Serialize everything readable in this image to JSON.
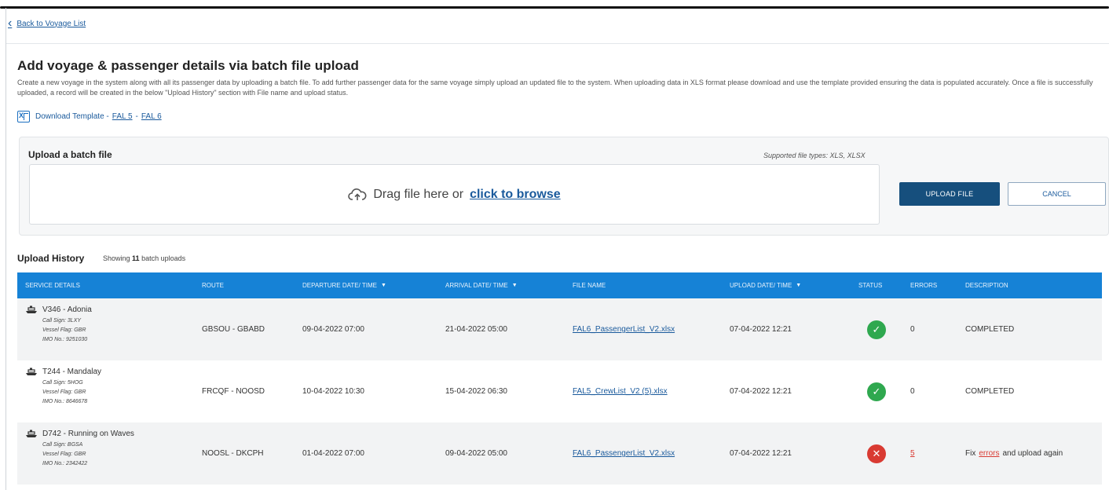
{
  "nav": {
    "back_label": "Back to Voyage List"
  },
  "page": {
    "title": "Add voyage & passenger details via batch file upload",
    "description": "Create a new voyage in the system along with all its passenger data by uploading a batch file. To add further passenger data for the same voyage simply upload an updated file to the system. When uploading data in XLS format please download and use the template provided ensuring the data is populated accurately. Once a file is successfully uploaded, a record will be created in the below \"Upload History\" section with File name and upload status."
  },
  "template": {
    "label": "Download Template -",
    "fal5": "FAL 5",
    "separator": "-",
    "fal6": "FAL 6",
    "icon": "excel-icon"
  },
  "upload": {
    "title": "Upload a batch file",
    "supported": "Supported file types: XLS, XLSX",
    "drag_text": "Drag file here or",
    "browse_text": "click to browse",
    "upload_button": "UPLOAD FILE",
    "cancel_button": "CANCEL",
    "icon": "cloud-upload-icon"
  },
  "history": {
    "title": "Upload History",
    "count_prefix": "Showing",
    "count": "11",
    "count_suffix": "batch uploads",
    "headers": {
      "service": "SERVICE DETAILS",
      "route": "ROUTE",
      "departure": "DEPARTURE DATE/ TIME",
      "arrival": "ARRIVAL DATE/ TIME",
      "file": "FILE NAME",
      "upload": "UPLOAD DATE/ TIME",
      "status": "STATUS",
      "errors": "ERRORS",
      "description": "DESCRIPTION"
    },
    "rows": [
      {
        "service": "V346 - Adonia",
        "call_sign": "Call Sign: 3LXY",
        "vessel_flag": "Vessel Flag: GBR",
        "imo": "IMO No.: 9251030",
        "route": "GBSOU - GBABD",
        "departure": "09-04-2022 07:00",
        "arrival": "21-04-2022 05:00",
        "file": "FAL6_PassengerList_V2.xlsx",
        "upload": "07-04-2022 12:21",
        "status": "success",
        "errors": "0",
        "description": "COMPLETED"
      },
      {
        "service": "T244 - Mandalay",
        "call_sign": "Call Sign: 5HOG",
        "vessel_flag": "Vessel Flag: GBR",
        "imo": "IMO No.: 8646678",
        "route": "FRCQF - NOOSD",
        "departure": "10-04-2022 10:30",
        "arrival": "15-04-2022 06:30",
        "file": "FAL5_CrewList_V2 (5).xlsx",
        "upload": "07-04-2022 12:21",
        "status": "success",
        "errors": "0",
        "description": "COMPLETED"
      },
      {
        "service": "D742 - Running on Waves",
        "call_sign": "Call Sign: BGSA",
        "vessel_flag": "Vessel Flag: GBR",
        "imo": "IMO No.: 2342422",
        "route": "NOOSL - DKCPH",
        "departure": "01-04-2022 07:00",
        "arrival": "09-04-2022 05:00",
        "file": "FAL6_PassengerList_V2.xlsx",
        "upload": "07-04-2022 12:21",
        "status": "error",
        "errors": "5",
        "description_prefix": "Fix",
        "description_link": "errors",
        "description_suffix": "and upload again"
      }
    ]
  },
  "colors": {
    "header_blue": "#1682d6",
    "primary_button": "#164f7d",
    "link": "#1a5a9c",
    "success": "#2fa84f",
    "error": "#d93a32"
  }
}
